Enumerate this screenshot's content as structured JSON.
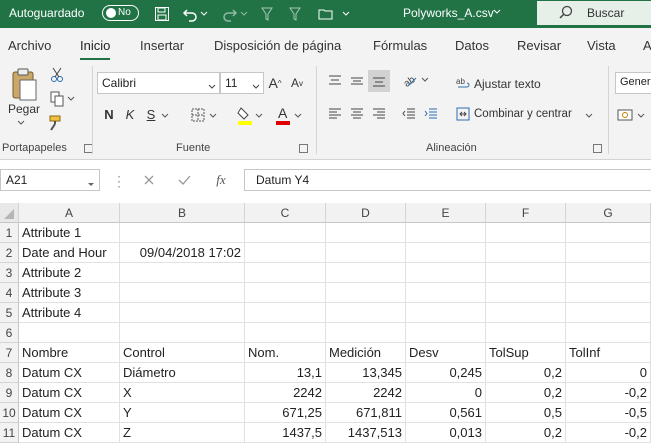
{
  "titlebar": {
    "autosave_label": "Autoguardado",
    "toggle_state": "No",
    "filename": "Polyworks_A.csv",
    "search_placeholder": "Buscar"
  },
  "tabs": [
    "Archivo",
    "Inicio",
    "Insertar",
    "Disposición de página",
    "Fórmulas",
    "Datos",
    "Revisar",
    "Vista",
    "A"
  ],
  "ribbon": {
    "clipboard": {
      "paste_label": "Pegar",
      "group_label": "Portapapeles"
    },
    "font": {
      "font_name": "Calibri",
      "font_size": "11",
      "group_label": "Fuente",
      "bold": "N",
      "italic": "K",
      "underline": "S"
    },
    "alignment": {
      "wrap_text": "Ajustar texto",
      "merge_center": "Combinar y centrar",
      "group_label": "Alineación"
    },
    "number": {
      "format": "Genera"
    }
  },
  "formula_bar": {
    "name_box": "A21",
    "content": "Datum Y4",
    "fx": "fx"
  },
  "sheet": {
    "columns": [
      "A",
      "B",
      "C",
      "D",
      "E",
      "F",
      "G"
    ],
    "rows": [
      {
        "n": "1",
        "cells": [
          "Attribute 1",
          "",
          "",
          "",
          "",
          "",
          ""
        ]
      },
      {
        "n": "2",
        "cells": [
          "Date and Hour",
          "09/04/2018 17:02",
          "",
          "",
          "",
          "",
          ""
        ]
      },
      {
        "n": "3",
        "cells": [
          "Attribute 2",
          "",
          "",
          "",
          "",
          "",
          ""
        ]
      },
      {
        "n": "4",
        "cells": [
          "Attribute 3",
          "",
          "",
          "",
          "",
          "",
          ""
        ]
      },
      {
        "n": "5",
        "cells": [
          "Attribute 4",
          "",
          "",
          "",
          "",
          "",
          ""
        ]
      },
      {
        "n": "6",
        "cells": [
          "",
          "",
          "",
          "",
          "",
          "",
          ""
        ]
      },
      {
        "n": "7",
        "cells": [
          "Nombre",
          "Control",
          "Nom.",
          "Medición",
          "Desv",
          "TolSup",
          "TolInf"
        ]
      },
      {
        "n": "8",
        "cells": [
          "Datum CX",
          "Diámetro",
          "13,1",
          "13,345",
          "0,245",
          "0,2",
          "0"
        ]
      },
      {
        "n": "9",
        "cells": [
          "Datum CX",
          "X",
          "2242",
          "2242",
          "0",
          "0,2",
          "-0,2"
        ]
      },
      {
        "n": "10",
        "cells": [
          "Datum CX",
          "Y",
          "671,25",
          "671,811",
          "0,561",
          "0,5",
          "-0,5"
        ]
      },
      {
        "n": "11",
        "cells": [
          "Datum CX",
          "Z",
          "1437,5",
          "1437,513",
          "0,013",
          "0,2",
          "-0,2"
        ]
      }
    ]
  },
  "colors": {
    "excel_green": "#217346",
    "ribbon_bg": "#f3f3f3",
    "header_bg": "#f2f2f2"
  }
}
